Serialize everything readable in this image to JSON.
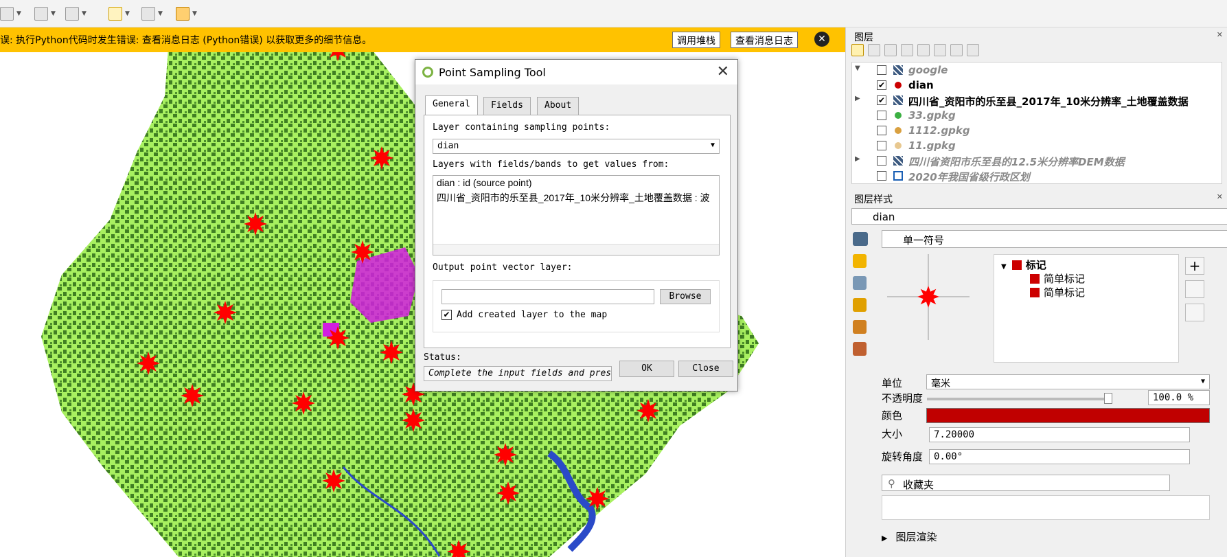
{
  "colors": {
    "message_bar": "#ffc200",
    "map_light_green": "#a8f060",
    "map_dark_green": "#2e6b18",
    "map_magenta": "#d21ee0",
    "map_blue": "#2a4ac8",
    "marker_red": "#ff0000",
    "symbol_color": "#c00000"
  },
  "message_bar": {
    "text": "误: 执行Python代码时发生错误: 查看消息日志 (Python错误) 以获取更多的细节信息。",
    "stack_button": "调用堆栈",
    "log_button": "查看消息日志",
    "close_icon": "close-circle-icon"
  },
  "dialog": {
    "title": "Point Sampling Tool",
    "close_glyph": "✕",
    "tabs": [
      {
        "label": "General",
        "active": true
      },
      {
        "label": "Fields",
        "active": false
      },
      {
        "label": "About",
        "active": false
      }
    ],
    "sampling_label": "Layer containing sampling points:",
    "sampling_value": "dian",
    "values_label": "Layers with fields/bands to get values from:",
    "value_layers": [
      "dian : id (source point)",
      "四川省_资阳市的乐至县_2017年_10米分辨率_土地覆盖数据 : 波"
    ],
    "output_label": "Output point vector layer:",
    "output_value": "",
    "browse_button": "Browse",
    "add_layer_checked": true,
    "add_layer_label": "Add created layer to the map",
    "status_label": "Status:",
    "status_value": "Complete the input fields and press OK...",
    "ok_button": "OK",
    "close_button": "Close"
  },
  "layers_panel": {
    "title": "图层",
    "layers": [
      {
        "name": "google",
        "checked": false,
        "expandable": "expanded",
        "icon": "raster-icon",
        "enabled": false
      },
      {
        "name": "dian",
        "checked": true,
        "expandable": "none",
        "icon": "point-red-icon",
        "enabled": true
      },
      {
        "name": "四川省_资阳市的乐至县_2017年_10米分辨率_土地覆盖数据",
        "checked": true,
        "expandable": "collapsed",
        "icon": "raster-icon",
        "enabled": true
      },
      {
        "name": "33.gpkg",
        "checked": false,
        "expandable": "none",
        "icon": "point-green-icon",
        "enabled": false
      },
      {
        "name": "1112.gpkg",
        "checked": false,
        "expandable": "none",
        "icon": "point-orange-icon",
        "enabled": false
      },
      {
        "name": "11.gpkg",
        "checked": false,
        "expandable": "none",
        "icon": "point-tan-icon",
        "enabled": false
      },
      {
        "name": "四川省资阳市乐至县的12.5米分辨率DEM数据",
        "checked": false,
        "expandable": "collapsed",
        "icon": "raster-icon",
        "enabled": false
      },
      {
        "name": "2020年我国省级行政区划",
        "checked": false,
        "expandable": "none",
        "icon": "polygon-icon",
        "enabled": false
      }
    ]
  },
  "style_panel": {
    "title": "图层样式",
    "layer": "dian",
    "renderer": "单一符号",
    "symbol_root": "标记",
    "symbol_layers": [
      "简单标记",
      "简单标记"
    ],
    "unit_label": "单位",
    "unit_value": "毫米",
    "opacity_label": "不透明度",
    "opacity_value": "100.0 %",
    "opacity_fraction": 1.0,
    "color_label": "颜色",
    "size_label": "大小",
    "size_value": "7.20000",
    "rotation_label": "旋转角度",
    "rotation_value": "0.00°",
    "search_value": "收藏夹",
    "layer_render_label": "图层渲染"
  }
}
